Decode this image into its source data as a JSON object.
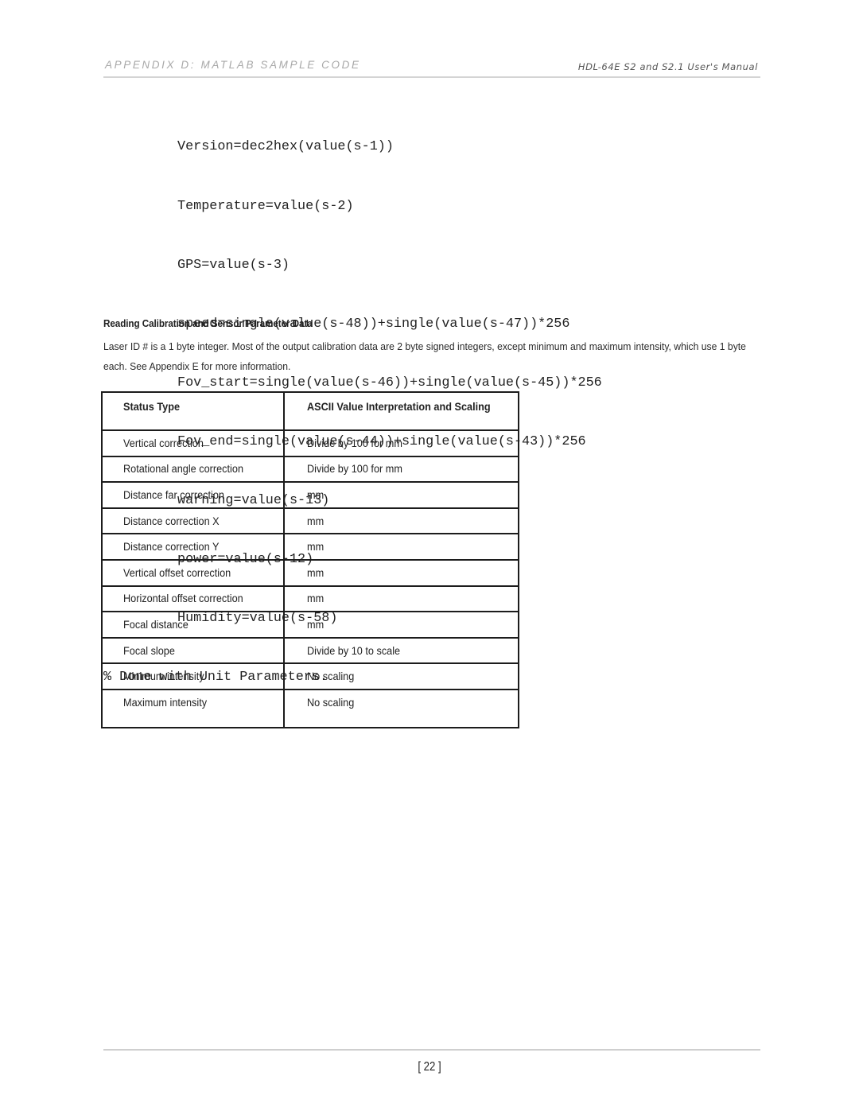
{
  "header": {
    "section_title": "APPENDIX D:  MATLAB SAMPLE CODE",
    "manual_title": "HDL-64E S2 and S2.1 User's Manual"
  },
  "code": {
    "lines": [
      "Version=dec2hex(value(s-1))",
      "Temperature=value(s-2)",
      "GPS=value(s-3)",
      "speed=single(value(s-48))+single(value(s-47))*256",
      "Fov_start=single(value(s-46))+single(value(s-45))*256",
      "Fov_end=single(value(s-44))+single(value(s-43))*256",
      "warning=value(s-13)",
      "power=value(s-12)",
      "Humidity=value(s-58)"
    ],
    "comment": "% Done with Unit Parameters."
  },
  "section": {
    "title": "Reading Calibration and Sensor Parameter Data",
    "paragraph": "Laser ID # is a 1 byte integer. Most of the output calibration data are 2 byte signed integers, except minimum and maximum intensity, which use 1 byte each. See Appendix E for more information."
  },
  "table": {
    "headers": [
      "Status Type",
      "ASCII Value Interpretation and Scaling"
    ],
    "rows": [
      [
        "Vertical correction",
        "Divide by 100 for mm"
      ],
      [
        "Rotational angle correction",
        "Divide by 100 for mm"
      ],
      [
        "Distance far correction",
        "mm"
      ],
      [
        "Distance correction X",
        "mm"
      ],
      [
        "Distance correction Y",
        "mm"
      ],
      [
        "Vertical offset correction",
        "mm"
      ],
      [
        "Horizontal offset correction",
        "mm"
      ],
      [
        "Focal distance",
        "mm"
      ],
      [
        "Focal slope",
        "Divide by 10 to scale"
      ],
      [
        "Minimum intensity",
        "No scaling"
      ],
      [
        "Maximum intensity",
        "No scaling"
      ]
    ]
  },
  "footer": {
    "page_number": "[ 22 ]"
  }
}
